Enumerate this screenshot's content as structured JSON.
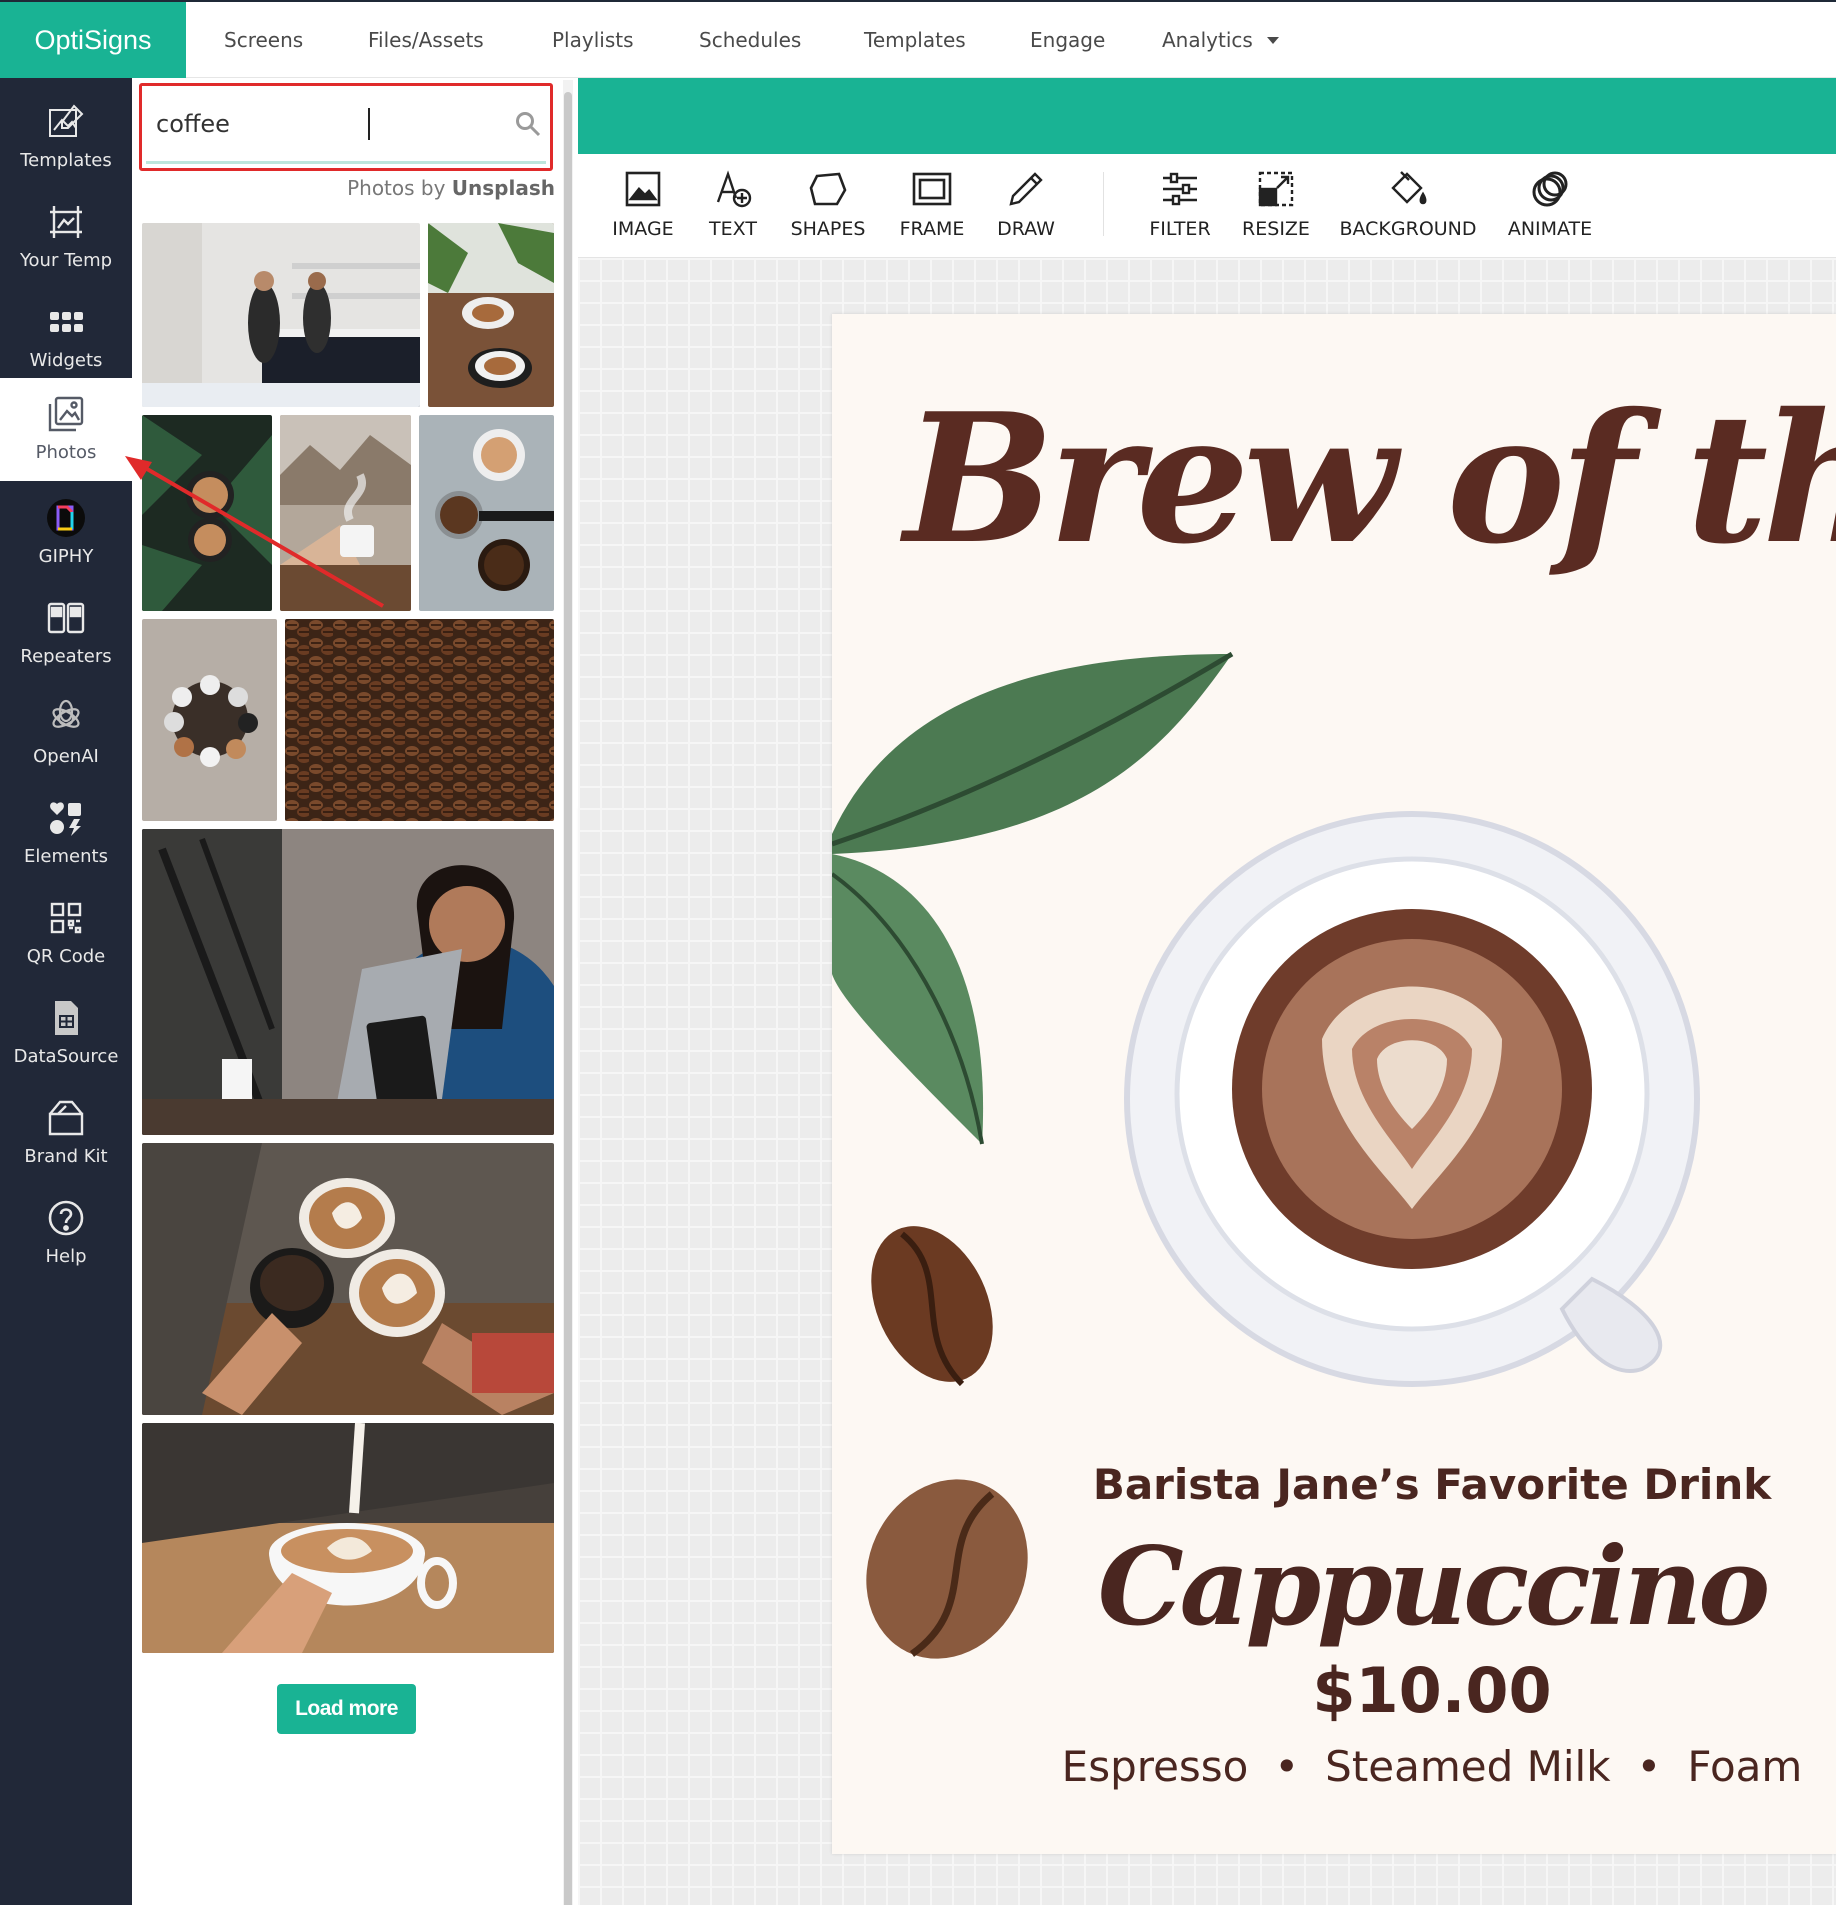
{
  "app": {
    "brand": "OptiSigns"
  },
  "topnav": {
    "items": [
      "Screens",
      "Files/Assets",
      "Playlists",
      "Schedules",
      "Templates",
      "Engage",
      "Analytics"
    ]
  },
  "sidebar": {
    "items": [
      {
        "label": "Templates",
        "icon": "templates-icon"
      },
      {
        "label": "Your Temp",
        "icon": "your-templates-icon"
      },
      {
        "label": "Widgets",
        "icon": "widgets-icon"
      },
      {
        "label": "Photos",
        "icon": "photos-icon",
        "active": true
      },
      {
        "label": "GIPHY",
        "icon": "giphy-icon"
      },
      {
        "label": "Repeaters",
        "icon": "repeaters-icon"
      },
      {
        "label": "OpenAI",
        "icon": "openai-icon"
      },
      {
        "label": "Elements",
        "icon": "elements-icon"
      },
      {
        "label": "QR Code",
        "icon": "qr-code-icon"
      },
      {
        "label": "DataSource",
        "icon": "datasource-icon"
      },
      {
        "label": "Brand Kit",
        "icon": "brand-kit-icon"
      },
      {
        "label": "Help",
        "icon": "help-icon"
      }
    ]
  },
  "photos": {
    "search_value": "coffee",
    "credit_prefix": "Photos by",
    "credit_source": "Unsplash",
    "load_more": "Load more"
  },
  "toolbar": {
    "tools": [
      "IMAGE",
      "TEXT",
      "SHAPES",
      "FRAME",
      "DRAW",
      "FILTER",
      "RESIZE",
      "BACKGROUND",
      "ANIMATE"
    ]
  },
  "artboard": {
    "title": "Brew of the W",
    "subtitle": "Barista Jane’s Favorite Drink",
    "drink": "Cappuccino",
    "price": "$10.00",
    "ingredients": [
      "Espresso",
      "Steamed Milk",
      "Foam"
    ],
    "separator": "•"
  },
  "colors": {
    "accent": "#19b394",
    "sidebar": "#212838",
    "highlight": "#e02a2a",
    "brown": "#5a2b22"
  }
}
